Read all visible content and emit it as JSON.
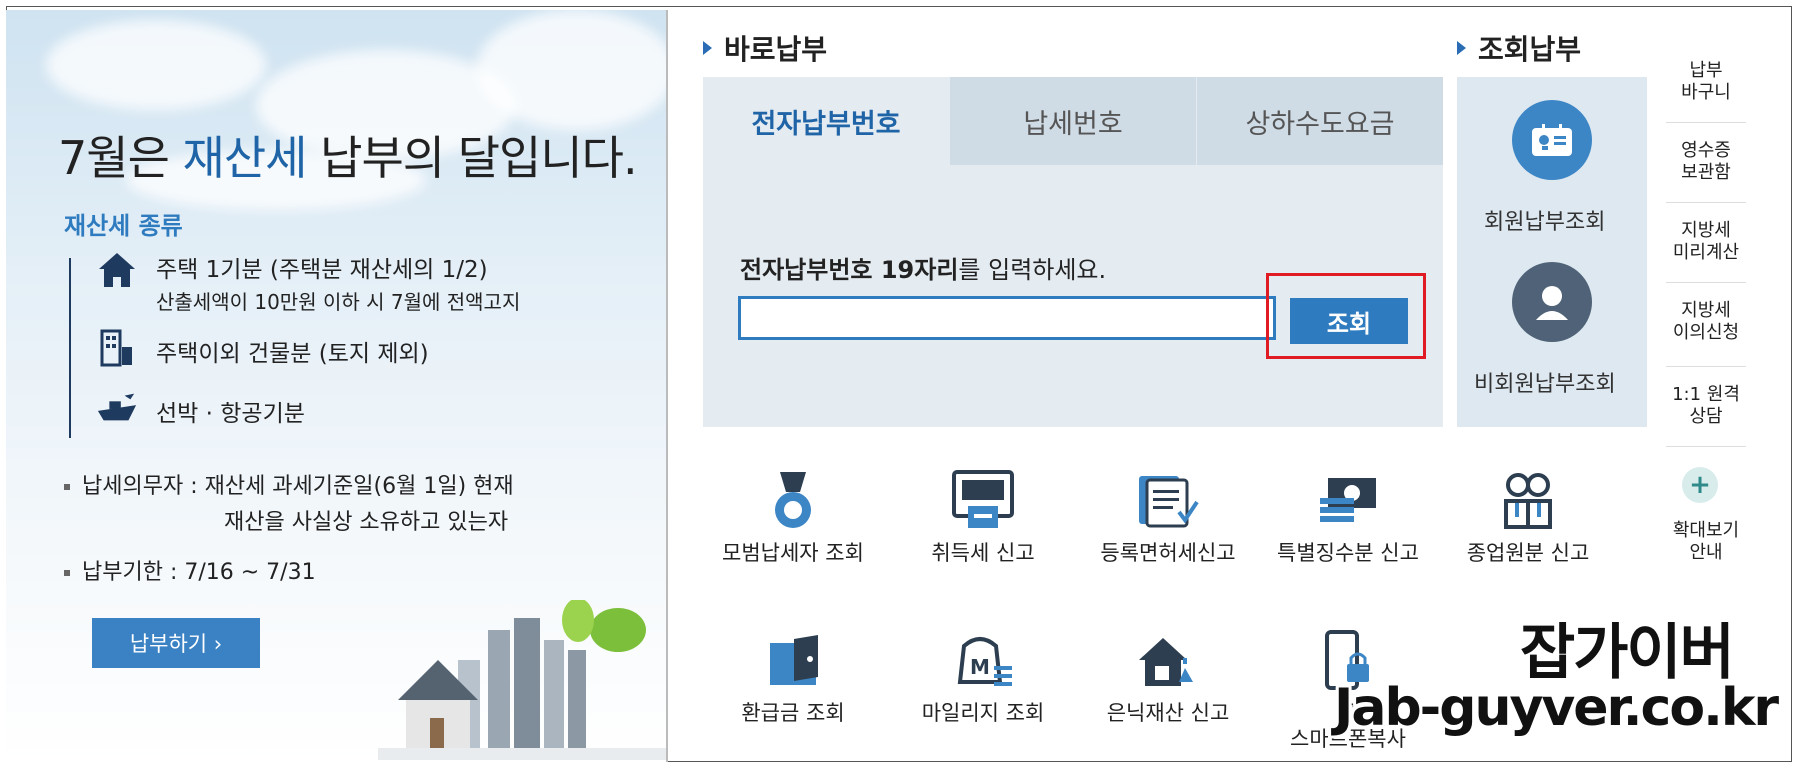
{
  "banner": {
    "title_prefix": "7월은 ",
    "title_highlight": "재산세",
    "title_suffix": " 납부의 달입니다.",
    "kinds_heading": "재산세 종류",
    "kinds": [
      {
        "icon": "house-icon",
        "line1": "주택 1기분 (주택분 재산세의 1/2)",
        "line2": "산출세액이 10만원 이하 시 7월에 전액고지"
      },
      {
        "icon": "building-icon",
        "line1": "주택이외 건물분 (토지 제외)",
        "line2": ""
      },
      {
        "icon": "ship-icon",
        "line1": "선박 · 항공기분",
        "line2": ""
      }
    ],
    "taxpayer_line1": "납세의무자 : 재산세 과세기준일(6월 1일) 현재",
    "taxpayer_line2": "재산을 사실상 소유하고 있는자",
    "deadline": "납부기한 : 7/16 ~ 7/31",
    "pay_button": "납부하기 ›"
  },
  "direct_pay": {
    "title": "바로납부",
    "tabs": [
      {
        "label": "전자납부번호",
        "active": true
      },
      {
        "label": "납세번호",
        "active": false
      },
      {
        "label": "상하수도요금",
        "active": false
      }
    ],
    "prompt_bold": "전자납부번호 19자리",
    "prompt_rest": "를 입력하세요.",
    "input_value": "",
    "query_button": "조회"
  },
  "lookup_pay": {
    "title": "조회납부",
    "member": "회원납부조회",
    "nonmember": "비회원납부조회"
  },
  "sidebar": {
    "items": [
      "납부\n바구니",
      "영수증\n보관함",
      "지방세\n미리계산",
      "지방세\n이의신청",
      "1:1 원격\n상담"
    ],
    "zoom": "확대보기\n안내"
  },
  "services_row1": [
    {
      "icon": "medal-icon",
      "label": "모범납세자 조회"
    },
    {
      "icon": "atm-icon",
      "label": "취득세 신고"
    },
    {
      "icon": "document-icon",
      "label": "등록면허세신고"
    },
    {
      "icon": "money-icon",
      "label": "특별징수분 신고"
    },
    {
      "icon": "employees-icon",
      "label": "종업원분 신고"
    }
  ],
  "services_row2": [
    {
      "icon": "wallet-icon",
      "label": "환급금 조회"
    },
    {
      "icon": "mileage-bag-icon",
      "label": "마일리지 조회"
    },
    {
      "icon": "hidden-house-icon",
      "label": "은닉재산 신고"
    },
    {
      "icon": "smartphone-lock-icon",
      "label": "공\n스마트폰복사"
    }
  ],
  "watermark": {
    "line1": "잡가이버",
    "line2": "Jab-guyver.co.kr"
  },
  "colors": {
    "accent": "#2f7bbf",
    "highlight": "#1f64a7",
    "red": "#e01b24"
  }
}
